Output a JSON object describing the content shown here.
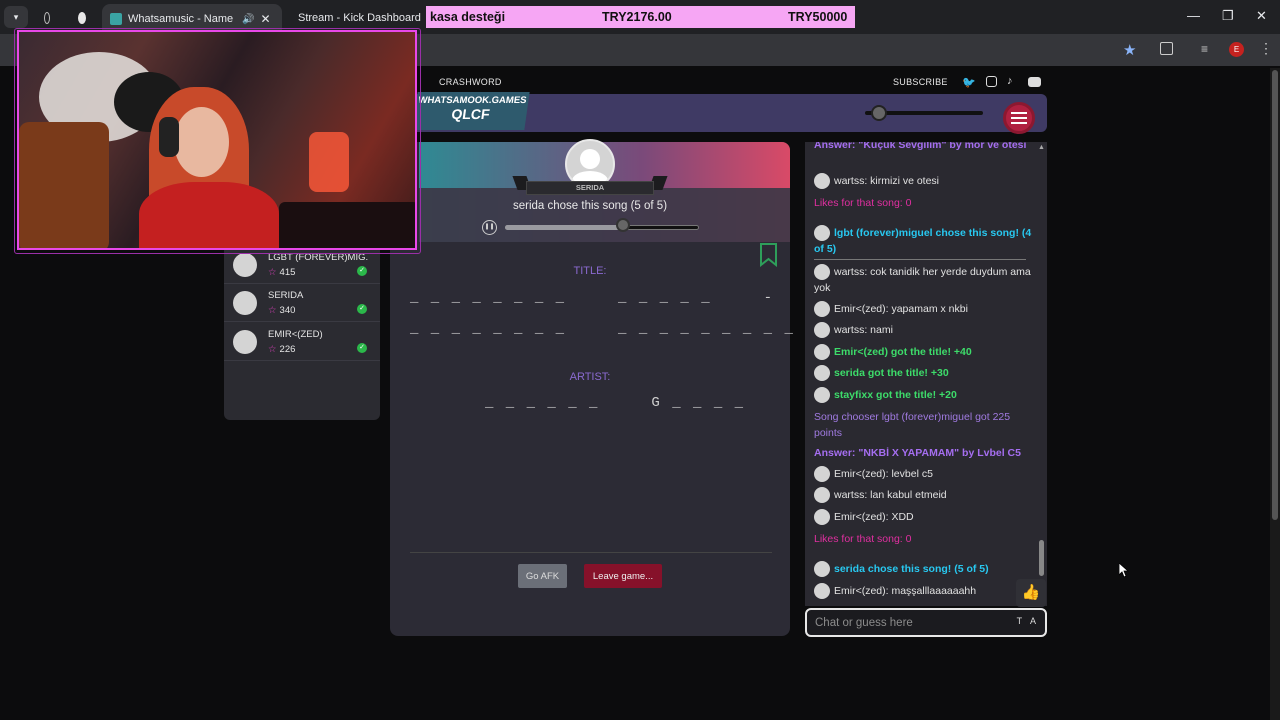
{
  "browser": {
    "tabs": [
      {
        "label": "",
        "active": false
      },
      {
        "label": "Whatsamusic - Name That",
        "active": true
      },
      {
        "label": "Stream - Kick Dashboard",
        "active": false
      }
    ],
    "profile_initial": "E"
  },
  "donation_bar": {
    "label": "kasa desteği",
    "current": "TRY2176.00",
    "goal": "TRY50000"
  },
  "site_nav": {
    "crashword": "CRASHWORD",
    "subscribe": "SUBSCRIBE"
  },
  "logo": {
    "site": "WHATSAMOOK.GAMES",
    "code": "QLCF"
  },
  "players": [
    {
      "name": "LGBT (FOREVER)MIG...",
      "score": "415"
    },
    {
      "name": "SERIDA",
      "score": "340"
    },
    {
      "name": "EMIR<(ZED)",
      "score": "226"
    }
  ],
  "song": {
    "chooser": "SERIDA",
    "chose_text": "serida chose this song (5 of 5)",
    "progress": 0.61
  },
  "guess": {
    "title_label": "TITLE:",
    "title_line1": "_ _ _ _ _ _ _ _     _ _ _ _ _     -",
    "title_line2": "_ _ _ _ _ _ _ _     _ _ _ _ _ _ _ _ _",
    "artist_label": "ARTIST:",
    "artist_line": "_ _ _ _ _ _     G _ _ _ _"
  },
  "buttons": {
    "afk": "Go AFK",
    "leave": "Leave game..."
  },
  "chat": {
    "messages": [
      {
        "kind": "answer",
        "text": "Answer: \"Küçük Sevgilim\" by mor ve ötesi"
      },
      {
        "kind": "user",
        "text": "wartss: kirmizi ve otesi"
      },
      {
        "kind": "likes",
        "text": "Likes for that song: 0"
      },
      {
        "kind": "chose",
        "text": "lgbt (forever)miguel chose this song! (4 of 5)"
      },
      {
        "kind": "user",
        "text": "wartss: cok tanidik her yerde duydum ama yok"
      },
      {
        "kind": "user",
        "text": "Emir<(zed): yapamam x nkbi"
      },
      {
        "kind": "user",
        "text": "wartss: nami"
      },
      {
        "kind": "got",
        "text": "Emir<(zed) got the title! +40"
      },
      {
        "kind": "got",
        "text": "serida got the title! +30"
      },
      {
        "kind": "got",
        "text": "stayfixx got the title! +20"
      },
      {
        "kind": "system",
        "text": "Song chooser lgbt (forever)miguel got 225 points"
      },
      {
        "kind": "answer",
        "text": "Answer: \"NKBİ X YAPAMAM\" by Lvbel C5"
      },
      {
        "kind": "user",
        "text": "Emir<(zed): levbel c5"
      },
      {
        "kind": "user",
        "text": "wartss: lan kabul etmeid"
      },
      {
        "kind": "user",
        "text": "Emir<(zed): XDD"
      },
      {
        "kind": "likes",
        "text": "Likes for that song: 0"
      },
      {
        "kind": "chose",
        "text": "serida chose this song! (5 of 5)"
      },
      {
        "kind": "user",
        "text": "Emir<(zed): maşşalllaaaaaahh"
      }
    ],
    "placeholder": "Chat or guess here",
    "input_tools": "T A"
  },
  "colors": {
    "donation_bg": "#f6a6f4",
    "answer": "#a56ef0",
    "got": "#3ddc6a",
    "chose": "#28c8f0",
    "likes": "#e02fa0",
    "leave_button": "#86112a",
    "webcam_border": "#e848e8"
  },
  "icons": [
    "dropdown-icon",
    "globe-icon",
    "whatsamusic-favicon",
    "kick-favicon",
    "speaker-icon",
    "close-icon",
    "star-icon",
    "extensions-icon",
    "media-icon",
    "kebab-icon",
    "twitter-icon",
    "instagram-icon",
    "tiktok-icon",
    "discord-icon",
    "volume-icon",
    "hamburger-icon",
    "pause-icon",
    "bookmark-icon",
    "thumbs-up-icon",
    "check-icon"
  ]
}
